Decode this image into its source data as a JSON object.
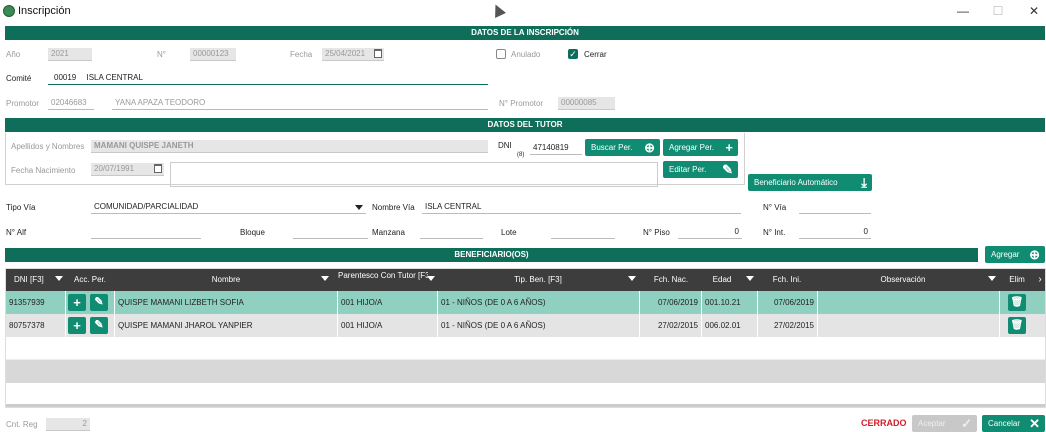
{
  "window": {
    "title": "Inscripción",
    "minimize": "—",
    "maximize": "☐",
    "close": "✕"
  },
  "sections": {
    "inscripcion": "DATOS DE LA INSCRIPCIÓN",
    "tutor": "DATOS DEL TUTOR",
    "beneficiarios": "BENEFICIARIO(OS)"
  },
  "inscripcion": {
    "anio_label": "Año",
    "anio_value": "2021",
    "numero_label": "N°",
    "numero_value": "00000123",
    "fecha_label": "Fecha",
    "fecha_value": "25/04/2021",
    "anulado_label": "Anulado",
    "anulado_checked": false,
    "cerrar_label": "Cerrar",
    "cerrar_checked": true,
    "comite_label": "Comité",
    "comite_code": "00019",
    "comite_name": "ISLA CENTRAL",
    "promotor_label": "Promotor",
    "promotor_code": "02046683",
    "promotor_name": "YANA APAZA TEODORO",
    "npromotor_label": "N° Promotor",
    "npromotor_value": "00000085"
  },
  "tutor": {
    "nombres_label": "Apellidos y Nombres",
    "nombres_value": "MAMANI QUISPE JANETH",
    "dni_label": "DNI",
    "dni_sub": "(8)",
    "dni_value": "47140819",
    "buscar_label": "Buscar Per.",
    "agregar_label": "Agregar Per.",
    "editar_label": "Editar Per.",
    "fnac_label": "Fecha Nacimiento",
    "fnac_value": "20/07/1991",
    "benef_auto_label": "Beneficiario Automático"
  },
  "direccion": {
    "tipo_via_label": "Tipo Vía",
    "tipo_via_value": "COMUNIDAD/PARCIALIDAD",
    "nombre_via_label": "Nombre Vía",
    "nombre_via_value": "ISLA CENTRAL",
    "n_via_label": "N° Vía",
    "n_via_value": "",
    "n_alf_label": "N° Alf",
    "bloque_label": "Bloque",
    "manzana_label": "Manzana",
    "lote_label": "Lote",
    "n_piso_label": "N° Piso",
    "n_piso_value": "0",
    "n_int_label": "N° Int.",
    "n_int_value": "0"
  },
  "grid": {
    "agregar_label": "Agregar",
    "headers": {
      "dni": "DNI [F3]",
      "acc": "Acc. Per.",
      "nombre": "Nombre",
      "parentesco": "Parentesco Con Tutor [F3]",
      "tipben": "Tip. Ben.   [F3]",
      "fnac": "Fch. Nac.",
      "edad": "Edad",
      "fini": "Fch. Ini.",
      "obs": "Observación",
      "elim": "Elim"
    },
    "rows": [
      {
        "dni": "91357939",
        "nombre": "QUISPE MAMANI LIZBETH SOFIA",
        "parentesco": "001 HIJO/A",
        "tipben": "01 - NIÑOS (DE 0 A 6 AÑOS)",
        "fnac": "07/06/2019",
        "edad": "001.10.21",
        "fini": "07/06/2019",
        "obs": ""
      },
      {
        "dni": "80757378",
        "nombre": "QUISPE MAMANI JHAROL YANPIER",
        "parentesco": "001 HIJO/A",
        "tipben": "01 - NIÑOS (DE 0 A 6 AÑOS)",
        "fnac": "27/02/2015",
        "edad": "006.02.01",
        "fini": "27/02/2015",
        "obs": ""
      }
    ]
  },
  "footer": {
    "cnt_label": "Cnt. Reg",
    "cnt_value": "2",
    "status": "CERRADO",
    "aceptar_label": "Aceptar",
    "cancelar_label": "Cancelar"
  },
  "colors": {
    "accent": "#0f6e5a",
    "button": "#0f8c72",
    "status": "#d0202a",
    "selected_row": "#8fd0c0"
  }
}
